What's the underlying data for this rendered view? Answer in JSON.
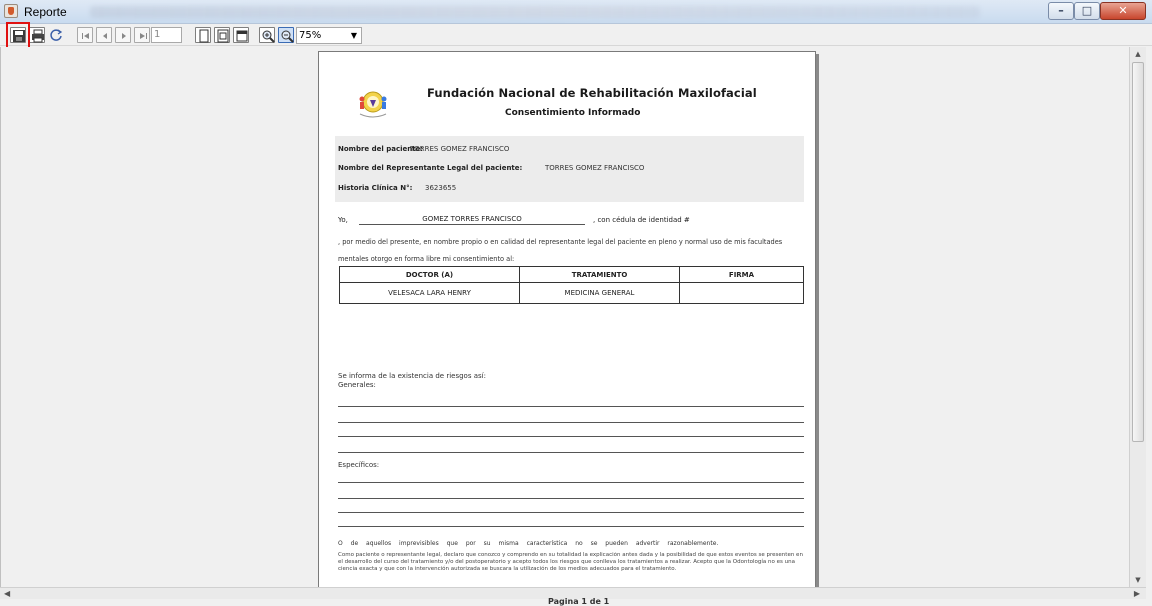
{
  "window": {
    "title": "Reporte"
  },
  "toolbar": {
    "page_number": "1",
    "zoom": "75%"
  },
  "document": {
    "title": "Fundación Nacional de Rehabilitación Maxilofacial",
    "subtitle": "Consentimiento Informado",
    "patient_label": "Nombre del paciente:",
    "patient_value": "TORRES GOMEZ FRANCISCO",
    "rep_label": "Nombre del Representante Legal del paciente:",
    "rep_value": "TORRES GOMEZ FRANCISCO",
    "history_label": "Historia Clínica N°:",
    "history_value": "3623655",
    "yo_label": "Yo,",
    "yo_name": "GOMEZ TORRES FRANCISCO",
    "cedula_text": ", con cédula de identidad #",
    "para1": ", por medio del presente, en nombre propio o en calidad del representante legal del paciente en pleno  y normal uso de mis facultades mentales otorgo en forma libre mi consentimiento al:",
    "table": {
      "headers": [
        "DOCTOR (A)",
        "TRATAMIENTO",
        "FIRMA"
      ],
      "row": [
        "VELESACA LARA HENRY",
        "MEDICINA GENERAL",
        ""
      ]
    },
    "riesgos_intro": "Se informa de la existencia de riesgos así:",
    "generales": "Generales:",
    "especificos": "Específicos:",
    "para2": "O de aquellos imprevisibles que por su misma característica no se pueden advertir razonablemente.",
    "para3": "Como paciente o representante legal, declaro que conozco y comprendo en su totalidad la explicación antes dada y la posibilidad de que estos eventos se presenten en el desarrollo del curso del tratamiento y/o del postoperatorio y acepto todos los riesgos que conlleva los tratamientos a realizar. Acepto que la Odontología no es una ciencia exacta y que con la intervención autorizada se buscara la utilización de los medios adecuados para el tratamiento."
  },
  "status": {
    "page_text": "Pagina 1 de 1"
  }
}
